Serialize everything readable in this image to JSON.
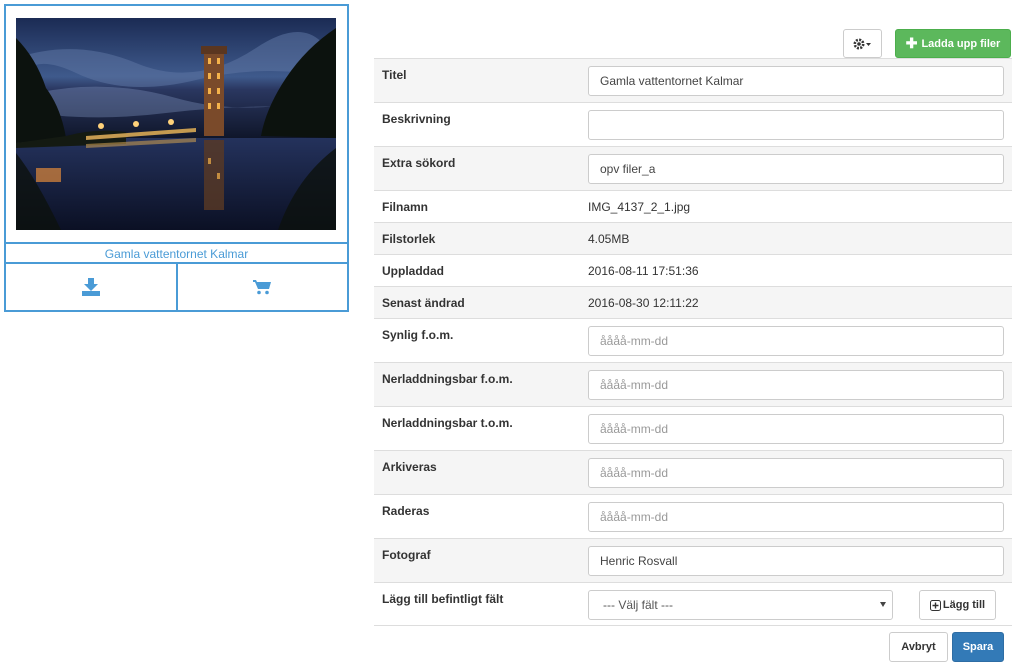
{
  "image_card": {
    "caption": "Gamla vattentornet Kalmar",
    "download_icon": "download-icon",
    "cart_icon": "cart-icon",
    "accent_color": "#4a9bd6"
  },
  "toolbar": {
    "settings_icon": "gear-icon",
    "upload_label": "Ladda upp filer",
    "upload_color": "#5cb85c"
  },
  "form": {
    "title": {
      "label": "Titel",
      "value": "Gamla vattentornet Kalmar"
    },
    "description": {
      "label": "Beskrivning",
      "value": ""
    },
    "keywords": {
      "label": "Extra sökord",
      "value": "opv filer_a"
    },
    "filename": {
      "label": "Filnamn",
      "value": "IMG_4137_2_1.jpg"
    },
    "filesize": {
      "label": "Filstorlek",
      "value": "4.05MB"
    },
    "uploaded": {
      "label": "Uppladdad",
      "value": "2016-08-11 17:51:36"
    },
    "modified": {
      "label": "Senast ändrad",
      "value": "2016-08-30 12:11:22"
    },
    "visible_from": {
      "label": "Synlig f.o.m.",
      "placeholder": "åååå-mm-dd"
    },
    "downloadable_from": {
      "label": "Nerladdningsbar f.o.m.",
      "placeholder": "åååå-mm-dd"
    },
    "downloadable_to": {
      "label": "Nerladdningsbar t.o.m.",
      "placeholder": "åååå-mm-dd"
    },
    "archived": {
      "label": "Arkiveras",
      "placeholder": "åååå-mm-dd"
    },
    "deleted": {
      "label": "Raderas",
      "placeholder": "åååå-mm-dd"
    },
    "photographer": {
      "label": "Fotograf",
      "value": "Henric Rosvall"
    },
    "add_field": {
      "label": "Lägg till befintligt fält",
      "select_value": "--- Välj fält ---",
      "button_label": "Lägg till"
    }
  },
  "footer": {
    "cancel_label": "Avbryt",
    "save_label": "Spara",
    "save_color": "#337ab7"
  }
}
